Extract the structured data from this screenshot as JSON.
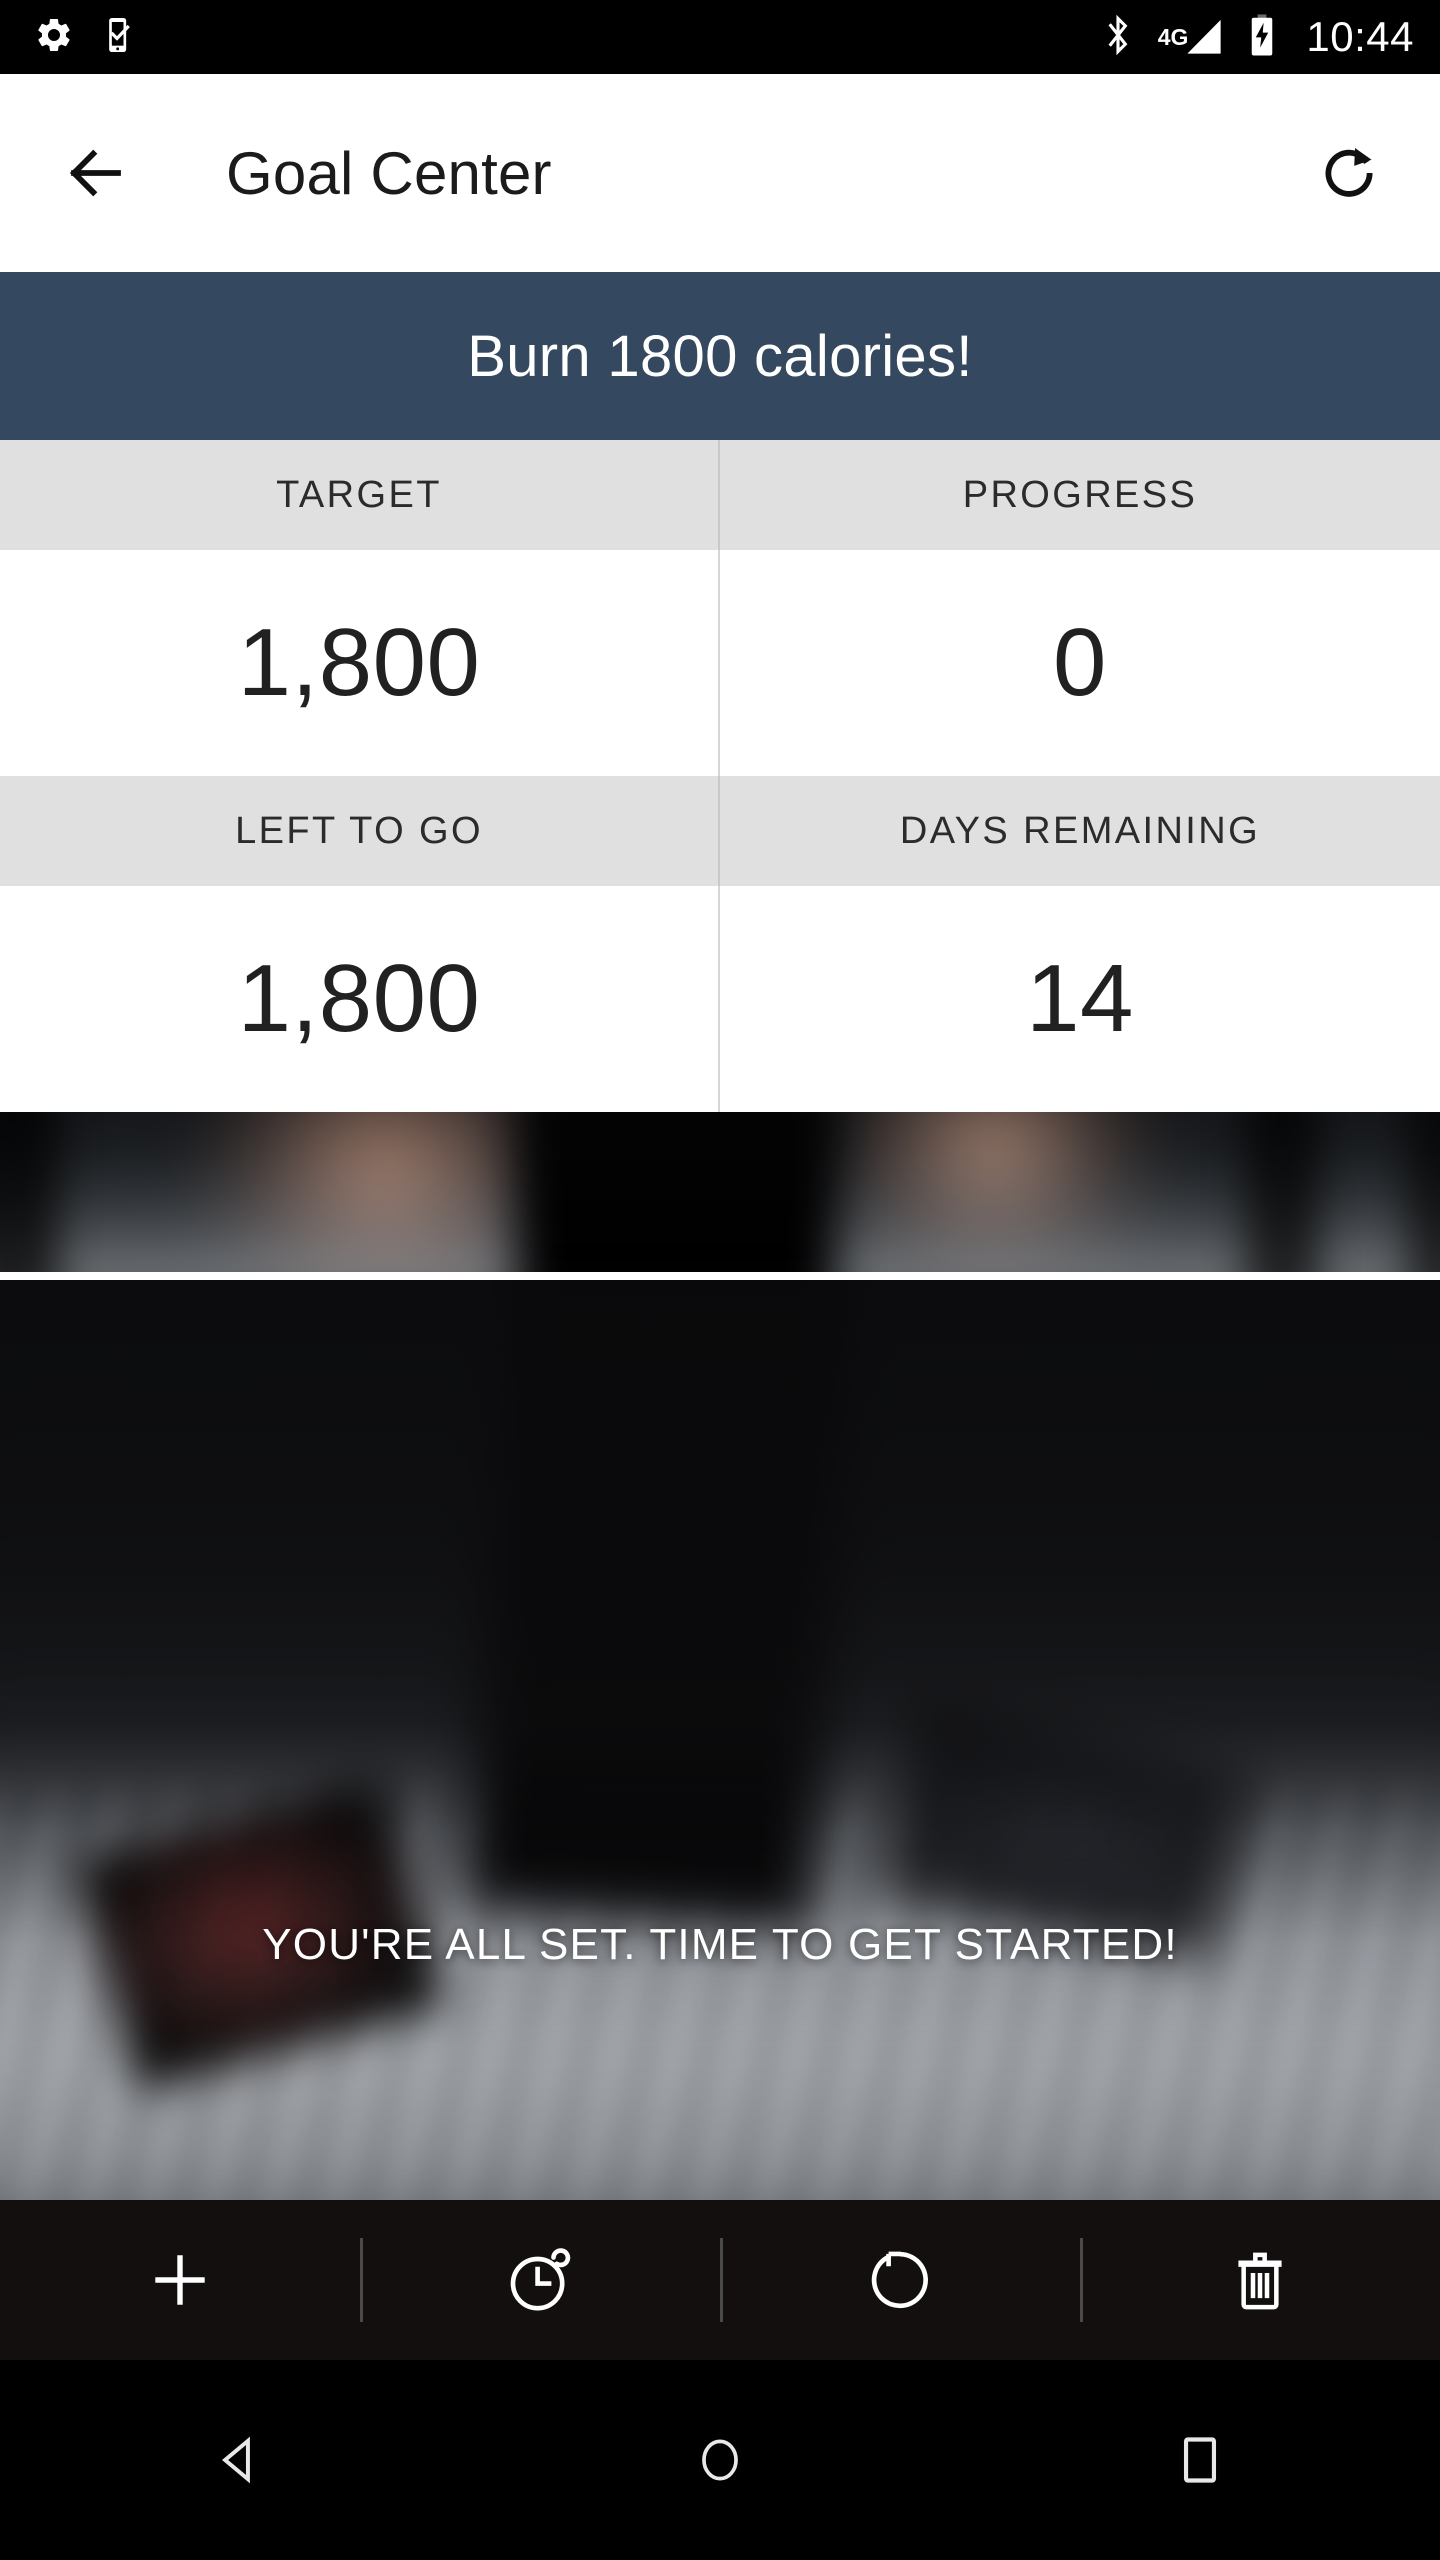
{
  "status_bar": {
    "icons_left": [
      "settings-gear-icon",
      "phone-check-icon"
    ],
    "icons_right": [
      "bluetooth-icon",
      "signal-4g-icon",
      "battery-charging-icon"
    ],
    "network_label": "4G",
    "time": "10:44"
  },
  "app_bar": {
    "back_icon": "back-arrow-icon",
    "title": "Goal Center",
    "refresh_icon": "refresh-icon"
  },
  "goal_banner": {
    "text": "Burn 1800 calories!",
    "background_color": "#34485f",
    "text_color": "#ffffff"
  },
  "stats": {
    "header_background": "#e0e0e0",
    "value_background": "#ffffff",
    "rows": [
      {
        "cells": [
          {
            "label": "TARGET",
            "value": "1,800"
          },
          {
            "label": "PROGRESS",
            "value": "0"
          }
        ]
      },
      {
        "cells": [
          {
            "label": "LEFT TO GO",
            "value": "1,800"
          },
          {
            "label": "DAYS REMAINING",
            "value": "14"
          }
        ]
      }
    ]
  },
  "photo": {
    "message": "YOU'RE ALL SET. TIME TO GET STARTED!",
    "message_color": "#ffffff"
  },
  "bottom_toolbar": {
    "background_color": "#140f0f",
    "items": [
      {
        "name": "add-goal-button",
        "icon": "plus-icon"
      },
      {
        "name": "history-button",
        "icon": "clock-timer-icon"
      },
      {
        "name": "reset-button",
        "icon": "rotate-reset-icon"
      },
      {
        "name": "delete-button",
        "icon": "trash-icon"
      }
    ]
  },
  "nav_bar": {
    "items": [
      {
        "name": "android-back-button",
        "icon": "nav-back-triangle-icon"
      },
      {
        "name": "android-home-button",
        "icon": "nav-home-circle-icon"
      },
      {
        "name": "android-recents-button",
        "icon": "nav-recents-square-icon"
      }
    ]
  }
}
